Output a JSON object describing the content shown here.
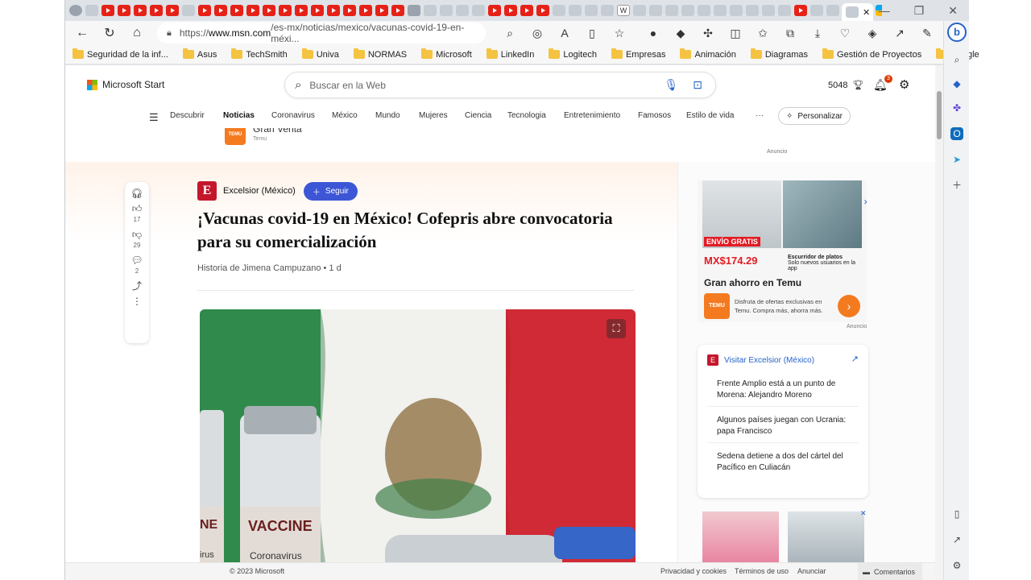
{
  "browser": {
    "address": {
      "scheme": "https://",
      "host": "www.msn.com",
      "path": "/es-mx/noticias/mexico/vacunas-covid-19-en-méxi..."
    },
    "bookmarks": [
      "Seguridad de la inf...",
      "Asus",
      "TechSmith",
      "Univa",
      "NORMAS",
      "Microsoft",
      "LinkedIn",
      "Logitech",
      "Empresas",
      "Animación",
      "Diagramas",
      "Gestión de Proyectos",
      "Google"
    ]
  },
  "msn": {
    "brand": "Microsoft Start",
    "search_placeholder": "Buscar en la Web",
    "points": "5048",
    "notif_count": "3",
    "nav": [
      "Descubrir",
      "Noticias",
      "Coronavirus",
      "México",
      "Mundo",
      "Mujeres",
      "Ciencia",
      "Tecnologia",
      "Entretenimiento",
      "Famosos",
      "Estilo de vida"
    ],
    "more": "···",
    "personalize": "Personalizar"
  },
  "top_ad": {
    "logo": "TEMU",
    "title": "Gran Venta",
    "source": "Temu",
    "label": "Anuncio"
  },
  "rail": {
    "likes": "17",
    "dislikes": "29",
    "comments": "2"
  },
  "article": {
    "publisher": "Excelsior (México)",
    "publisher_logo": "E",
    "follow": "Seguir",
    "title": "¡Vacunas covid-19 en México! Cofepris abre convocatoria para su comercialización",
    "byline": "Historia de Jimena Campuzano • 1 d",
    "image_text": {
      "vaccine": "VACCINE",
      "coronavirus": "Coronavirus",
      "ne": "NE",
      "irus": "irus"
    }
  },
  "side_ad": {
    "badge": "ENVÍO GRATIS",
    "price": "MX$174.29",
    "price_note_1": "Escurridor de platos",
    "price_note_2": "Solo nuevos usuarios en la app",
    "heading": "Gran ahorro en Temu",
    "logo": "TEMU",
    "desc": "Disfruta de ofertas exclusivas en Temu. Compra más, ahorra más.",
    "label": "Anuncio"
  },
  "visit": {
    "title": "Visitar Excelsior (México)",
    "items": [
      "Frente Amplio está a un punto de Morena: Alejandro Moreno",
      "Algunos países juegan con Ucrania: papa Francisco",
      "Sedena detiene a dos del cártel del Pacífico en Culiacán"
    ]
  },
  "footer": {
    "copyright": "© 2023 Microsoft",
    "privacy": "Privacidad y cookies",
    "terms": "Términos de uso",
    "advertise": "Anunciar",
    "comments": "Comentarios"
  },
  "colors": {
    "accent": "#3c56d6",
    "excelsior": "#c4172c",
    "temu": "#f47a20",
    "flag_green": "#2f8a4b",
    "flag_red": "#cf2a35"
  }
}
